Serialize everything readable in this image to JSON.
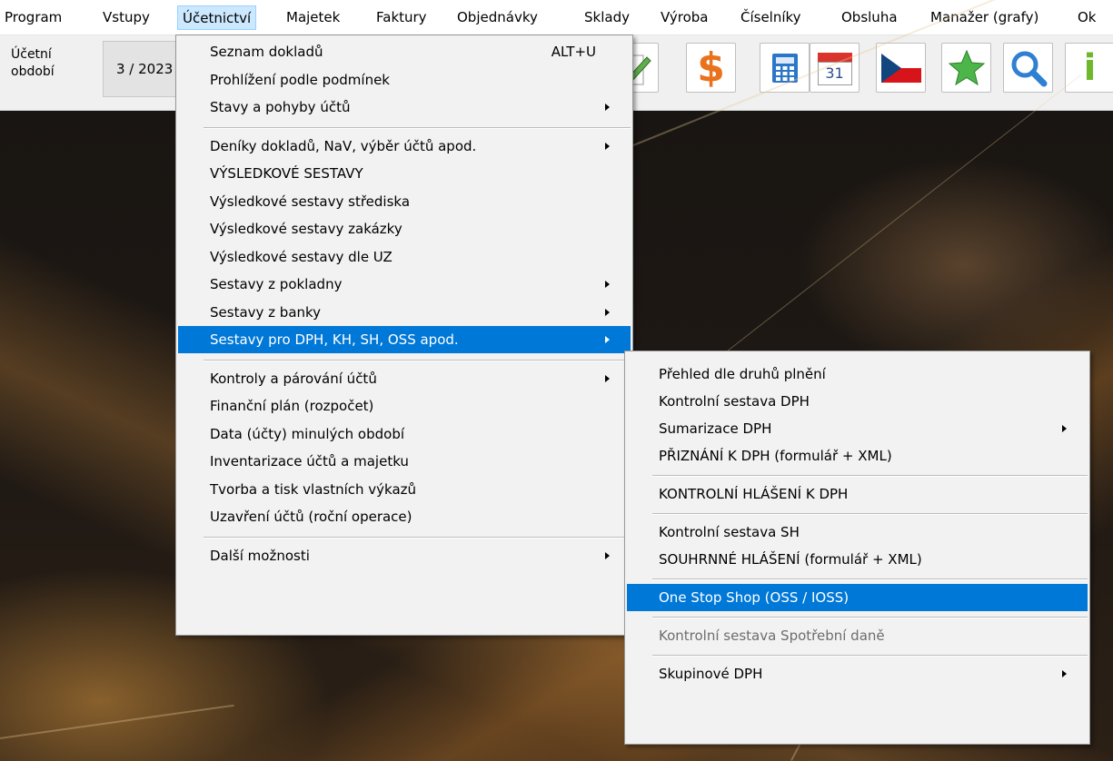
{
  "menubar": {
    "items": [
      "Program",
      "Vstupy",
      "Účetnictví",
      "Majetek",
      "Faktury",
      "Objednávky",
      "Sklady",
      "Výroba",
      "Číselníky",
      "Obsluha",
      "Manažer (grafy)",
      "Ok"
    ],
    "active_index": 2
  },
  "toolbar": {
    "period_label_line1": "Účetní",
    "period_label_line2": "období",
    "period_value": "3 / 2023",
    "calendar_day": "31",
    "info_glyph": "i",
    "dollar_glyph": "$",
    "icons": [
      "pencil-icon",
      "dollar-icon",
      "calculator-icon",
      "calendar-icon",
      "czech-flag-icon",
      "star-icon",
      "search-icon",
      "info-icon"
    ],
    "colors": {
      "dollar": "#e9731c",
      "calculator": "#2a76c8",
      "star": "#4cb648",
      "search": "#2f7fd3",
      "info": "#6fb82c",
      "flag_blue": "#11457e",
      "flag_red": "#d7141a"
    }
  },
  "menu_main": {
    "items": [
      {
        "label": "Seznam dokladů",
        "accel": "ALT+U"
      },
      {
        "label": "Prohlížení podle podmínek"
      },
      {
        "label": "Stavy a pohyby účtů",
        "submenu": true
      },
      {
        "separator": true
      },
      {
        "label": "Deníky dokladů, NaV, výběr účtů apod.",
        "submenu": true
      },
      {
        "label": "VÝSLEDKOVÉ SESTAVY"
      },
      {
        "label": "Výsledkové sestavy střediska"
      },
      {
        "label": "Výsledkové sestavy zakázky"
      },
      {
        "label": "Výsledkové sestavy dle UZ"
      },
      {
        "label": "Sestavy z pokladny",
        "submenu": true
      },
      {
        "label": "Sestavy z banky",
        "submenu": true
      },
      {
        "label": "Sestavy pro DPH, KH, SH, OSS apod.",
        "submenu": true,
        "highlighted": true
      },
      {
        "separator": true
      },
      {
        "label": "Kontroly a párování účtů",
        "submenu": true
      },
      {
        "label": "Finanční plán (rozpočet)"
      },
      {
        "label": "Data (účty) minulých období"
      },
      {
        "label": "Inventarizace účtů a majetku"
      },
      {
        "label": "Tvorba a tisk vlastních výkazů"
      },
      {
        "label": "Uzavření účtů (roční operace)"
      },
      {
        "separator": true
      },
      {
        "label": "Další možnosti",
        "submenu": true
      }
    ]
  },
  "menu_sub": {
    "items": [
      {
        "label": "Přehled dle druhů plnění"
      },
      {
        "label": "Kontrolní sestava DPH"
      },
      {
        "label": "Sumarizace DPH",
        "submenu": true
      },
      {
        "label": "PŘIZNÁNÍ K DPH  (formulář + XML)"
      },
      {
        "separator": true
      },
      {
        "label": "KONTROLNÍ HLÁŠENÍ K DPH"
      },
      {
        "separator": true
      },
      {
        "label": "Kontrolní sestava SH"
      },
      {
        "label": "SOUHRNNÉ HLÁŠENÍ (formulář + XML)"
      },
      {
        "separator": true
      },
      {
        "label": "One Stop Shop (OSS / IOSS)",
        "highlighted": true
      },
      {
        "separator": true
      },
      {
        "label": "Kontrolní sestava Spotřební daně",
        "disabled": true
      },
      {
        "separator": true
      },
      {
        "label": "Skupinové DPH",
        "submenu": true
      }
    ]
  }
}
